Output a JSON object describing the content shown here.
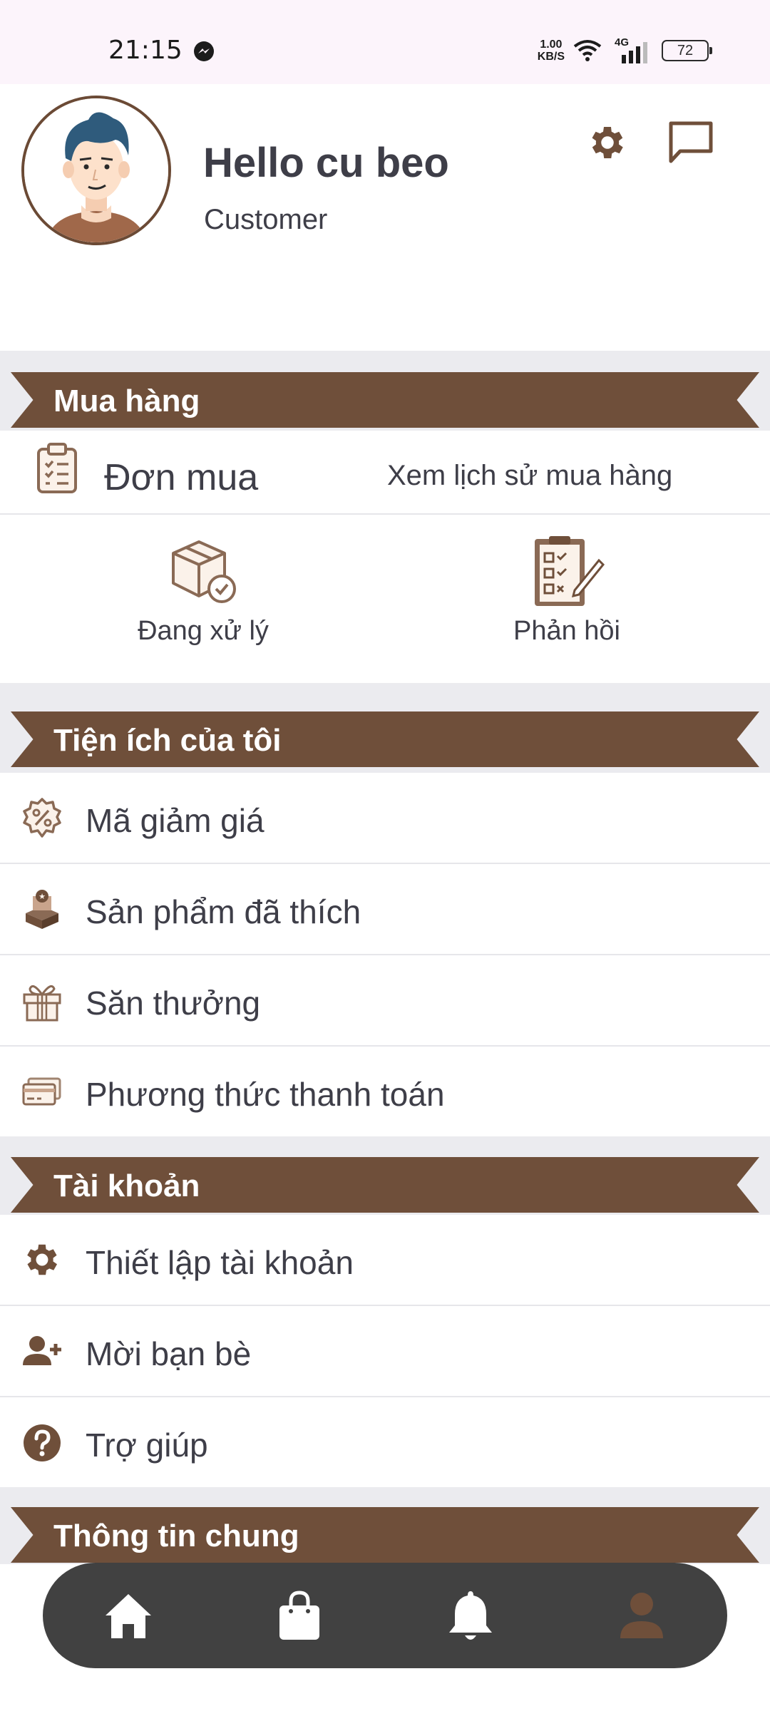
{
  "status_bar": {
    "time": "21:15",
    "speed_value": "1.00",
    "speed_unit": "KB/S",
    "network": "4G",
    "battery": "72",
    "icons": [
      "messenger-icon",
      "wifi-icon",
      "signal-icon",
      "battery-icon"
    ]
  },
  "header": {
    "greeting": "Hello cu beo",
    "role": "Customer",
    "icons": [
      "settings-icon",
      "chat-icon"
    ]
  },
  "sections": {
    "purchase": "Mua hàng",
    "utilities": "Tiện ích của tôi",
    "account": "Tài khoản",
    "general": "Thông tin chung"
  },
  "orders": {
    "title": "Đơn mua",
    "history_link": "Xem lịch sử mua hàng",
    "processing": "Đang xử lý",
    "feedback": "Phản hồi"
  },
  "utilities": {
    "items": [
      {
        "label": "Mã giảm giá",
        "icon": "discount-icon"
      },
      {
        "label": "Sản phẩm đã thích",
        "icon": "liked-products-icon"
      },
      {
        "label": "Săn thưởng",
        "icon": "gift-icon"
      },
      {
        "label": "Phương thức thanh toán",
        "icon": "payment-card-icon"
      }
    ]
  },
  "account": {
    "items": [
      {
        "label": "Thiết lập tài khoản",
        "icon": "gear-icon"
      },
      {
        "label": "Mời bạn bè",
        "icon": "add-user-icon"
      },
      {
        "label": "Trợ giúp",
        "icon": "help-icon"
      }
    ]
  },
  "bottom_nav": {
    "items": [
      "home-icon",
      "shopping-bag-icon",
      "bell-icon",
      "profile-icon"
    ],
    "active": "profile-icon"
  },
  "colors": {
    "brown": "#6f4f3a",
    "nav_bg": "#414141",
    "text": "#3e3e48"
  }
}
